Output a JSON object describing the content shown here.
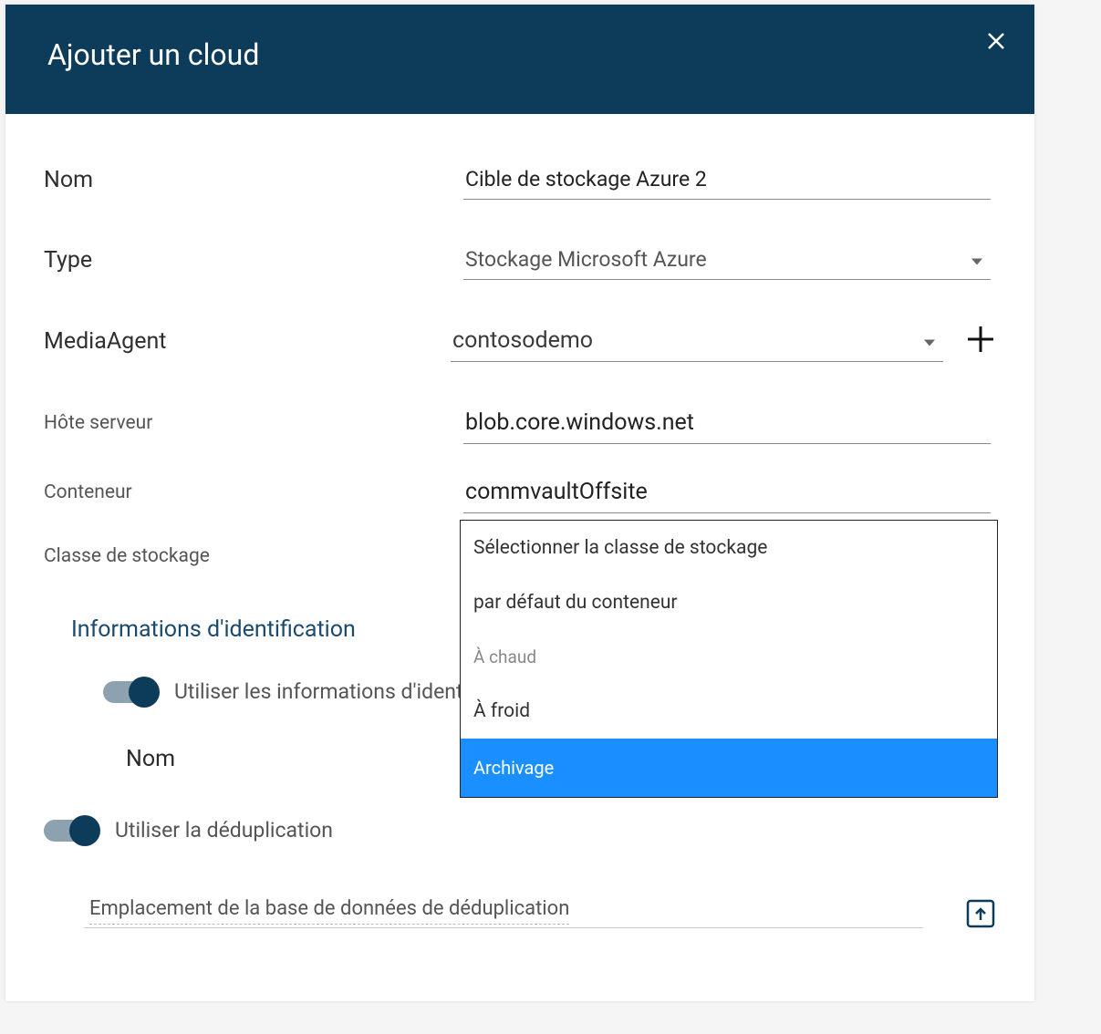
{
  "header": {
    "title": "Ajouter un cloud"
  },
  "form": {
    "name_label": "Nom",
    "name_value": "Cible de stockage Azure 2",
    "type_label": "Type",
    "type_value": "Stockage Microsoft Azure",
    "mediaagent_label": "MediaAgent",
    "mediaagent_value": "contosodemo",
    "host_label": "Hôte serveur",
    "host_value": "blob.core.windows.net",
    "container_label": "Conteneur",
    "container_value": "commvaultOffsite",
    "storageclass_label": "Classe de stockage",
    "storageclass_value": "Archivage"
  },
  "credentials": {
    "section_title": "Informations d'identification",
    "use_saved_label": "Utiliser les informations d'identification enregistrées",
    "name_label": "Nom"
  },
  "dedup": {
    "toggle_label": "Utiliser la déduplication",
    "location_label": "Emplacement de la base de données de déduplication"
  },
  "dropdown": {
    "options": [
      "Sélectionner la classe de stockage",
      "par défaut du conteneur",
      "À chaud",
      "À froid",
      "Archivage"
    ]
  }
}
